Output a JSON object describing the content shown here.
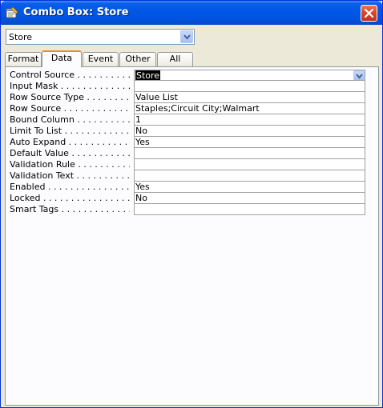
{
  "window": {
    "title": "Combo Box: Store",
    "icon": "properties-icon",
    "close_icon": "close-icon"
  },
  "object_selector": {
    "value": "Store",
    "icon": "chevron-down-icon"
  },
  "tabs": [
    {
      "label": "Format",
      "active": false
    },
    {
      "label": "Data",
      "active": true
    },
    {
      "label": "Event",
      "active": false
    },
    {
      "label": "Other",
      "active": false
    },
    {
      "label": "All",
      "active": false
    }
  ],
  "properties": [
    {
      "label": "Control Source . . . . . . . . . . . .",
      "value": "Store",
      "selected": true,
      "has_dropdown": true
    },
    {
      "label": "Input Mask . . . . . . . . . . . . . .",
      "value": ""
    },
    {
      "label": "Row Source Type . . . . . . . . .",
      "value": "Value List"
    },
    {
      "label": "Row Source . . . . . . . . . . . . . .",
      "value": "Staples;Circuit City;Walmart"
    },
    {
      "label": "Bound Column . . . . . . . . . . .",
      "value": "1"
    },
    {
      "label": "Limit To List . . . . . . . . . . . . .",
      "value": "No"
    },
    {
      "label": "Auto Expand . . . . . . . . . . . .",
      "value": "Yes"
    },
    {
      "label": "Default Value . . . . . . . . . . . .",
      "value": ""
    },
    {
      "label": "Validation Rule . . . . . . . . . . .",
      "value": ""
    },
    {
      "label": "Validation Text . . . . . . . . . . .",
      "value": ""
    },
    {
      "label": "Enabled . . . . . . . . . . . . . . . .",
      "value": "Yes"
    },
    {
      "label": "Locked . . . . . . . . . . . . . . . . .",
      "value": "No"
    },
    {
      "label": "Smart Tags . . . . . . . . . . . . . .",
      "value": ""
    }
  ],
  "colors": {
    "titlebar": "#0058e6",
    "active_tab_accent": "#e68b2c",
    "selection": "#000000"
  }
}
